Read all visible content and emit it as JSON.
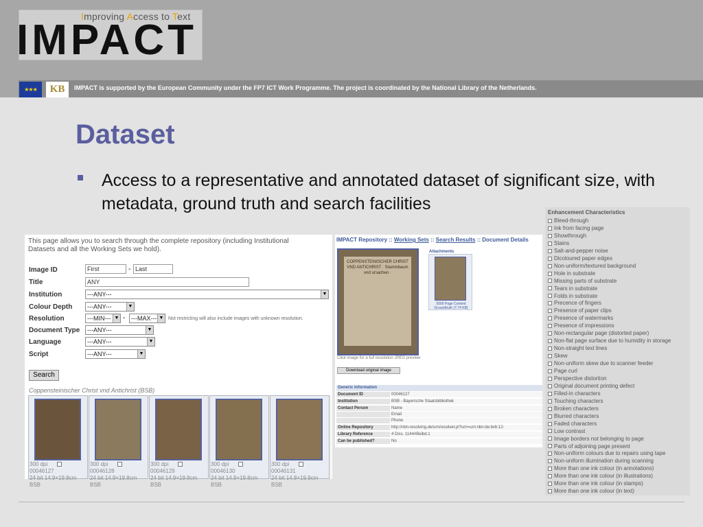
{
  "header": {
    "tagline_parts": [
      {
        "text": "I",
        "hl": true
      },
      {
        "text": "mproving ",
        "hl": false
      },
      {
        "text": "A",
        "hl": true
      },
      {
        "text": "ccess to ",
        "hl": false
      },
      {
        "text": "T",
        "hl": true
      },
      {
        "text": "ext",
        "hl": false
      }
    ],
    "logo_word": "IMPACT",
    "eu_stars": "★★★",
    "kb_logo": "KB",
    "support_text": "IMPACT is supported by the European Community under the FP7 ICT Work Programme. The project is coordinated by the National Library of the Netherlands."
  },
  "slide": {
    "title": "Dataset",
    "bullet": "Access to a representative and annotated dataset of significant size, with metadata, ground truth and search facilities"
  },
  "search": {
    "intro": "This page allows you to search through the complete repository (including Institutional Datasets and all the Working Sets we hold).",
    "labels": {
      "image_id": "Image ID",
      "title": "Title",
      "institution": "Institution",
      "colour_depth": "Colour Depth",
      "resolution": "Resolution",
      "document_type": "Document Type",
      "language": "Language",
      "script": "Script"
    },
    "image_id_first": "First",
    "image_id_sep": "-",
    "image_id_last": "Last",
    "title_value": "ANY",
    "institution_value": "---ANY---",
    "colour_depth_value": "---ANY---",
    "resolution_min": "---MIN---",
    "resolution_sep": "-",
    "resolution_max": "---MAX---",
    "resolution_note": "Not restricting will also include images with unknown resolution.",
    "document_type_value": "---ANY---",
    "language_value": "---ANY---",
    "script_value": "---ANY---",
    "search_button": "Search",
    "collection_label": "Coppensteinischer Christ vnd Antichrist (BSB)",
    "thumbs": [
      {
        "id": "00046127",
        "dpi": "300 dpi",
        "info": "24 bit 14.9×19.8cm BSB"
      },
      {
        "id": "00046128",
        "dpi": "300 dpi",
        "info": "24 bit 14.9×19.8cm BSB"
      },
      {
        "id": "00046129",
        "dpi": "300 dpi",
        "info": "24 bit 14.9×19.8cm BSB"
      },
      {
        "id": "00046130",
        "dpi": "300 dpi",
        "info": "24 bit 14.8×19.8cm BSB"
      },
      {
        "id": "00046131",
        "dpi": "300 dpi",
        "info": "24 bit 14.8×19.9cm BSB"
      }
    ]
  },
  "detail": {
    "crumb_root": "IMPACT Repository",
    "crumb_sep": "::",
    "crumb_working_sets": "Working Sets",
    "crumb_search_results": "Search Results",
    "crumb_document_details": "Document Details",
    "page_text": "COPPENSTEINISCHER CHRIST VND ANTICHRIST · Stammbaum vnd ursachen ·",
    "attachments_label": "Attachments",
    "attachment_caption": "5000 Page Content Groundtruth (7.74 KB)",
    "click_note": "Click image for a full resolution JPEG preview",
    "download_button": "Download original image",
    "info_header": "Generic Information",
    "info_rows": [
      {
        "k": "Document ID",
        "v": "00046127"
      },
      {
        "k": "Institution",
        "v": "BSB - Bayerische Staatsbibliothek"
      },
      {
        "k": "Contact Person",
        "v": "Name"
      },
      {
        "k": "",
        "v": "Email"
      },
      {
        "k": "",
        "v": "Phone"
      },
      {
        "k": "Online Repository",
        "v": "http://nbn-resolving.de/urn/resolver.pl?urn=urn:nbn:de:bvb:12-"
      },
      {
        "k": "Library Reference",
        "v": "4 Diss. 1144#Beibd.1"
      },
      {
        "k": "Can be published?",
        "v": "No"
      }
    ]
  },
  "enhancement": {
    "title": "Enhancement Characteristics",
    "items": [
      "Bleed-through",
      "Ink from facing page",
      "Showthrough",
      "Stains",
      "Salt-and-pepper noise",
      "Dicoloured paper edges",
      "Non-uniform/textured background",
      "Hole in substrate",
      "Missing parts of substrate",
      "Tears in substrate",
      "Folds in substrate",
      "Precence of fingers",
      "Presence of paper clips",
      "Presence of watermarks",
      "Presence of impressions",
      "Non-rectangular page (distorted paper)",
      "Non-flat page surface due to humidity in storage",
      "Non-straight text lines",
      "Skew",
      "Non-uniform skew due to scanner feeder",
      "Page curl",
      "Perspective distortion",
      "Original document printing defect",
      "Filled-in characters",
      "Touching characters",
      "Broken characters",
      "Blurred characters",
      "Faded characters",
      "Low contrast",
      "Image borders not belonging to page",
      "Parts of adjoining page present",
      "Non-uniform colours due to repairs using tape",
      "Non-uniform illumination during scanning",
      "More than one ink colour (in annotations)",
      "More than one ink colour (in illustrations)",
      "More than one ink colour (in stamps)",
      "More than one ink colour (in text)"
    ]
  }
}
